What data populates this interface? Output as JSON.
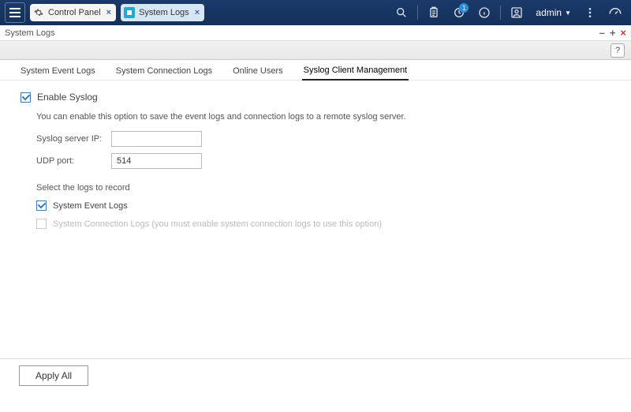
{
  "topbar": {
    "tabs": [
      {
        "label": "Control Panel",
        "icon_color": "#888"
      },
      {
        "label": "System Logs",
        "icon_color": "#1fa8d8"
      }
    ],
    "notification_badge": "1",
    "user_label": "admin"
  },
  "window": {
    "title": "System Logs"
  },
  "toolbar": {
    "help_label": "?"
  },
  "inner_tabs": [
    "System Event Logs",
    "System Connection Logs",
    "Online Users",
    "Syslog Client Management"
  ],
  "content": {
    "enable_label": "Enable Syslog",
    "enable_desc": "You can enable this option to save the event logs and connection logs to a remote syslog server.",
    "server_ip_label": "Syslog server IP:",
    "server_ip_value": "",
    "udp_port_label": "UDP port:",
    "udp_port_value": "514",
    "select_logs_label": "Select the logs to record",
    "opt_event_label": "System Event Logs",
    "opt_conn_label": "System Connection Logs (you must enable system connection logs to use this option)"
  },
  "footer": {
    "apply_label": "Apply All"
  }
}
